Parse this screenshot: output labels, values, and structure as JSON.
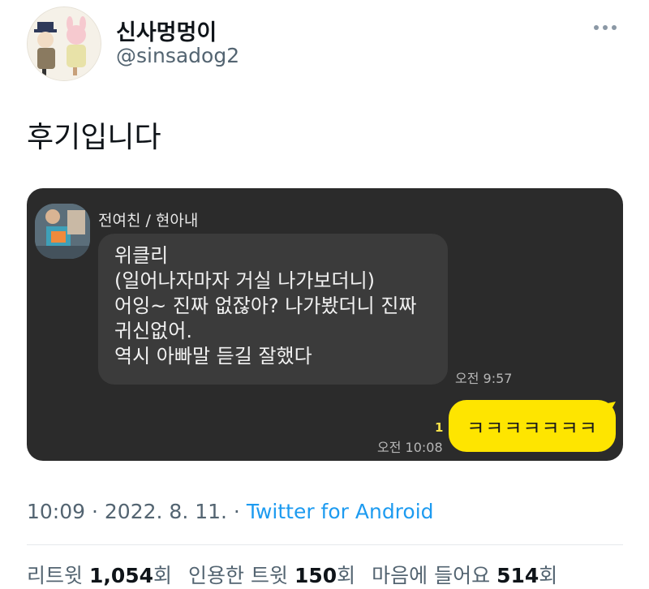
{
  "profile": {
    "display_name": "신사멍멍이",
    "handle": "@sinsadog2"
  },
  "tweet": {
    "text": "후기입니다"
  },
  "chat": {
    "sender": "전여친 / 현아내",
    "incoming_lines": [
      "위클리",
      "(일어나자마자 거실 나가보더니)",
      "어잉~ 진짜 없잖아? 나가봤더니 진짜",
      "귀신없어.",
      "역시 아빠말 듣길 잘했다"
    ],
    "incoming_time": "오전 9:57",
    "unread_count": "1",
    "outgoing_time": "오전 10:08",
    "outgoing_text": "ㅋㅋㅋㅋㅋㅋㅋ",
    "colors": {
      "background": "#2b2b2b",
      "incoming_bubble": "#3b3b3b",
      "outgoing_bubble": "#fee500"
    }
  },
  "meta": {
    "time": "10:09",
    "sep1": " · ",
    "date": "2022. 8. 11.",
    "sep2": " · ",
    "source": "Twitter for Android"
  },
  "stats": {
    "retweets_label": "리트윗 ",
    "retweets_value": "1,054",
    "retweets_unit": "회",
    "quotes_label": "인용한 트윗 ",
    "quotes_value": "150",
    "quotes_unit": "회",
    "likes_label": "마음에 들어요 ",
    "likes_value": "514",
    "likes_unit": "회"
  },
  "icons": {
    "more": "more-horizontal-icon"
  }
}
